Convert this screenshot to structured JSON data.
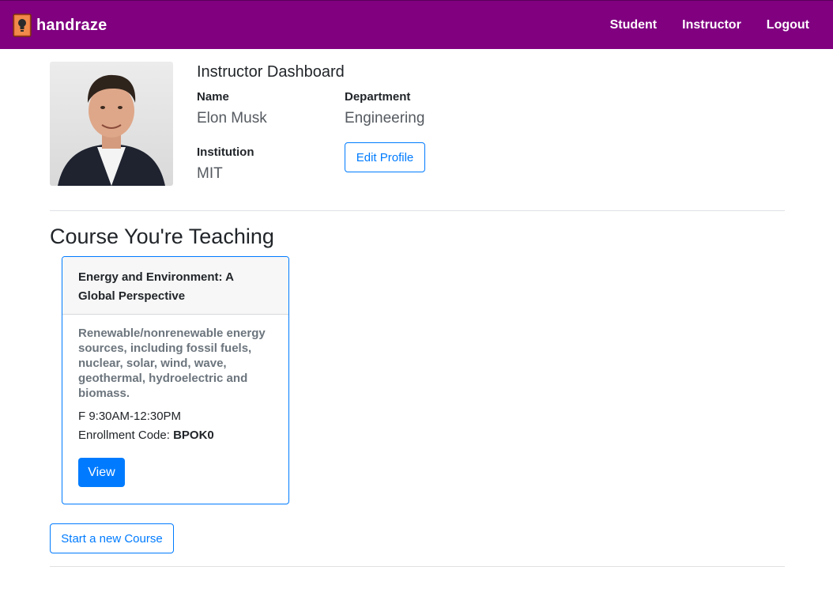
{
  "navbar": {
    "brand": "handraze",
    "logo_icon": "book-lightbulb-icon",
    "links": [
      "Student",
      "Instructor",
      "Logout"
    ],
    "background": "#800080"
  },
  "profile": {
    "dashboard_title": "Instructor Dashboard",
    "name_label": "Name",
    "name_value": "Elon Musk",
    "department_label": "Department",
    "department_value": "Engineering",
    "institution_label": "Institution",
    "institution_value": "MIT",
    "edit_button": "Edit Profile"
  },
  "courses_section": {
    "title": "Course You're Teaching",
    "courses": [
      {
        "title": "Energy and Environment: A Global Perspective",
        "description": "Renewable/nonrenewable energy sources, including fossil fuels, nuclear, solar, wind, wave, geothermal, hydroelectric and biomass.",
        "schedule": "F 9:30AM-12:30PM",
        "enrollment_label": "Enrollment Code:",
        "enrollment_code": "BPOK0",
        "view_button": "View"
      }
    ],
    "new_course_button": "Start a new Course"
  },
  "colors": {
    "primary": "#007bff",
    "muted": "#6c757d"
  }
}
